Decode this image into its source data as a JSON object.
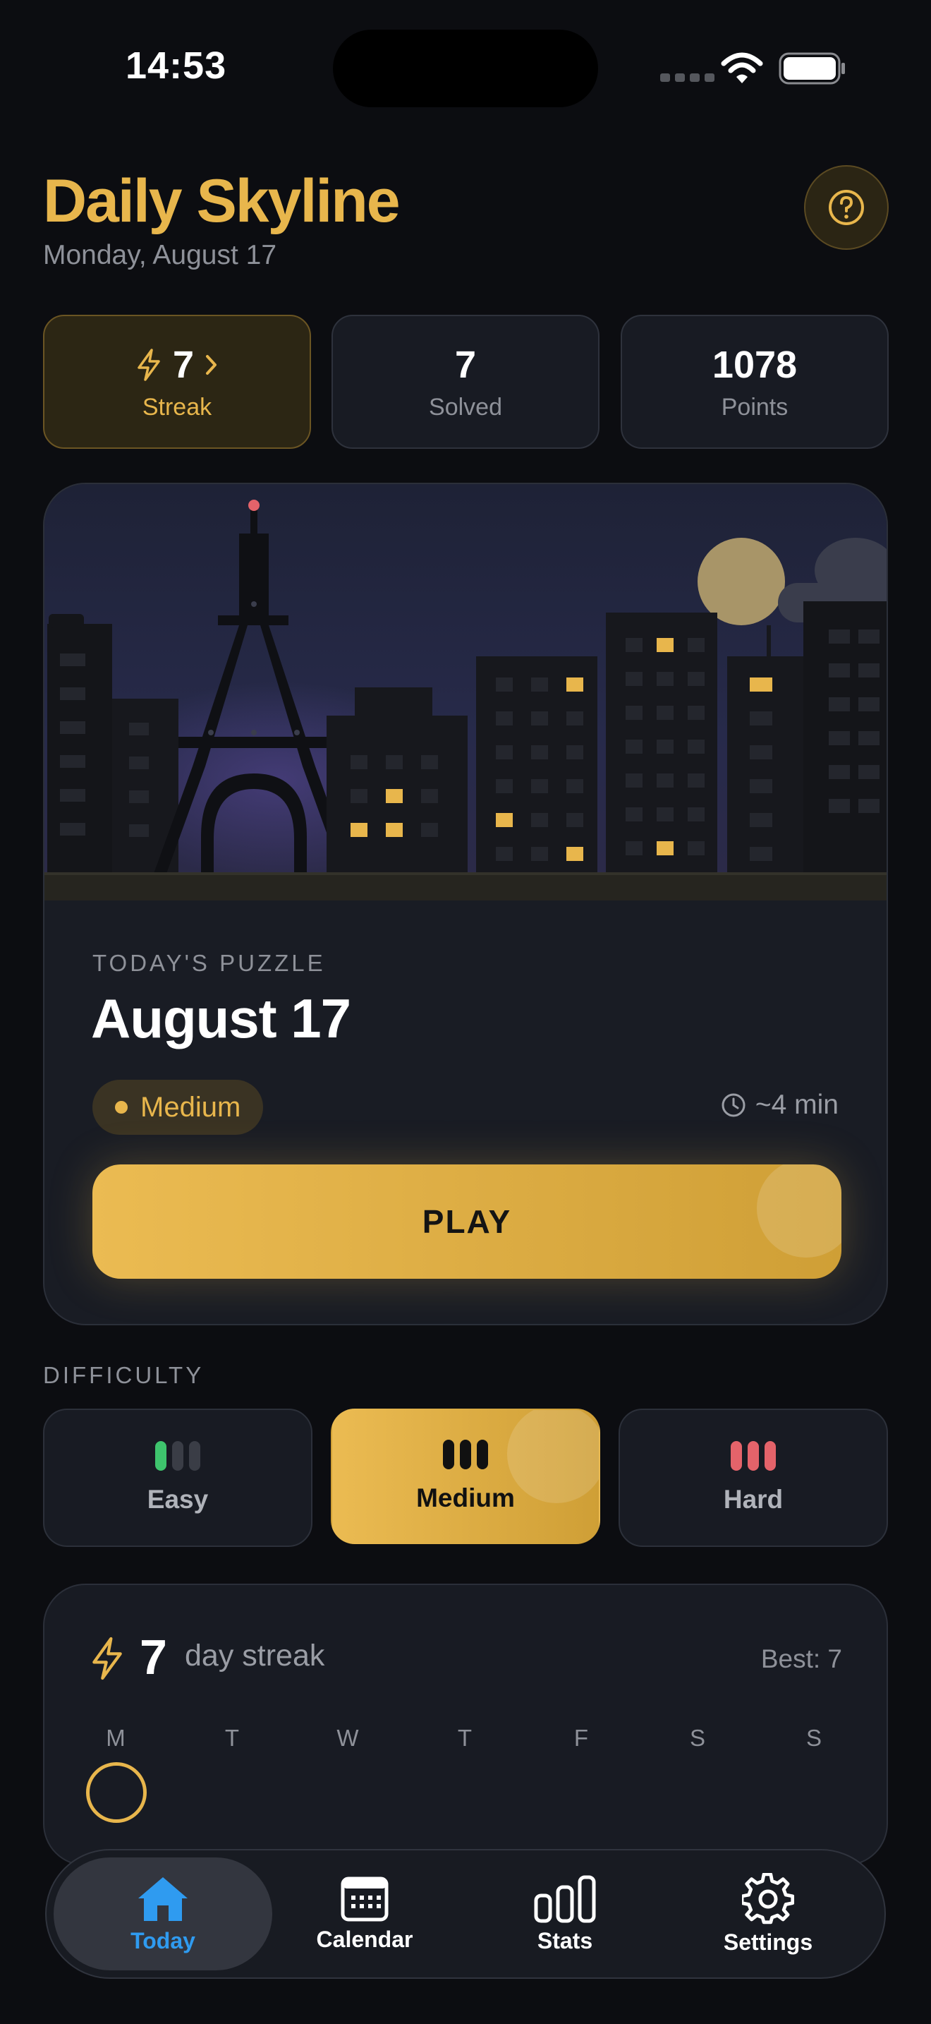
{
  "status_bar": {
    "time": "14:53"
  },
  "header": {
    "title": "Daily Skyline",
    "date": "Monday, August 17",
    "help_icon": "question-circle-icon"
  },
  "stats": [
    {
      "value": "7",
      "label": "Streak"
    },
    {
      "value": "7",
      "label": "Solved"
    },
    {
      "value": "1078",
      "label": "Points"
    }
  ],
  "puzzle": {
    "eyebrow": "TODAY'S PUZZLE",
    "title": "August 17",
    "difficulty": "Medium",
    "duration": "~4 min",
    "play_label": "PLAY"
  },
  "difficulty": {
    "section_label": "DIFFICULTY",
    "options": [
      {
        "label": "Easy",
        "selected": false,
        "bar_color": "#3ec46d"
      },
      {
        "label": "Medium",
        "selected": true,
        "bar_color": "#111111"
      },
      {
        "label": "Hard",
        "selected": false,
        "bar_color": "#e4636a"
      }
    ]
  },
  "streak": {
    "count": "7",
    "text": "day streak",
    "best": "Best: 7",
    "weekdays": [
      "M",
      "T",
      "W",
      "T",
      "F",
      "S",
      "S"
    ]
  },
  "tabs": [
    {
      "label": "Today",
      "icon": "house-icon",
      "active": true
    },
    {
      "label": "Calendar",
      "icon": "calendar-icon",
      "active": false
    },
    {
      "label": "Stats",
      "icon": "bar-chart-icon",
      "active": false
    },
    {
      "label": "Settings",
      "icon": "gear-icon",
      "active": false
    }
  ],
  "colors": {
    "accent": "#e8b64c",
    "tab_active": "#2f9bf0",
    "background": "#0c0d11"
  }
}
